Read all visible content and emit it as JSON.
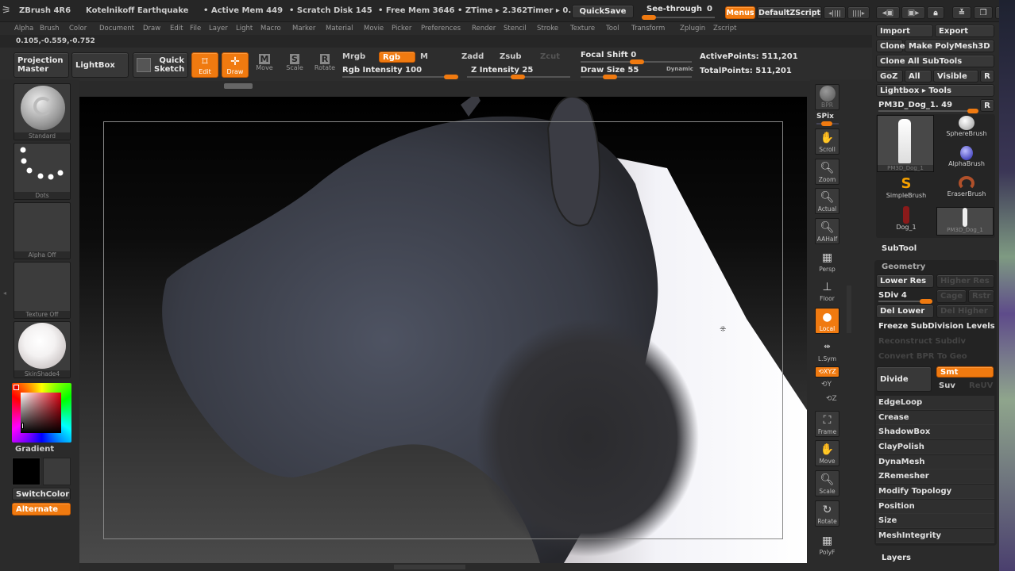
{
  "titlebar": {
    "app": "ZBrush 4R6",
    "document": "Kotelnikoff Earthquake",
    "active_mem": "• Active Mem 449",
    "scratch_disk": "• Scratch Disk 145",
    "free_mem": "• Free Mem 3646",
    "ztime": "• ZTime ▸ 2.362",
    "timer": "Timer ▸ 0.",
    "quicksave": "QuickSave",
    "see_through_label": "See-through",
    "see_through_value": "0",
    "menus": "Menus",
    "default_zscript": "DefaultZScript"
  },
  "menubar": [
    "Alpha",
    "Brush",
    "Color",
    "Document",
    "Draw",
    "Edit",
    "File",
    "Layer",
    "Light",
    "Macro",
    "Marker",
    "Material",
    "Movie",
    "Picker",
    "Preferences",
    "Render",
    "Stencil",
    "Stroke",
    "Texture",
    "Tool",
    "Transform",
    "Zplugin",
    "Zscript"
  ],
  "coords": "0.105,-0.559,-0.752",
  "shelf": {
    "projection_master": "Projection Master",
    "lightbox": "LightBox",
    "quick_sketch": "Quick Sketch",
    "edit": "Edit",
    "draw": "Draw",
    "move": "Move",
    "scale": "Scale",
    "rotate": "Rotate",
    "mrgb": "Mrgb",
    "rgb": "Rgb",
    "m": "M",
    "rgb_intensity": "Rgb Intensity 100",
    "zadd": "Zadd",
    "zsub": "Zsub",
    "zcut": "Zcut",
    "z_intensity": "Z Intensity 25",
    "focal_shift": "Focal Shift 0",
    "draw_size": "Draw Size 55",
    "dynamic": "Dynamic",
    "active_points": "ActivePoints: 511,201",
    "total_points": "TotalPoints: 511,201"
  },
  "left_tray": {
    "brush": "Standard",
    "stroke": "Dots",
    "alpha": "Alpha  Off",
    "texture": "Texture  Off",
    "material": "SkinShade4",
    "gradient": "Gradient",
    "switch_color": "SwitchColor",
    "alternate": "Alternate"
  },
  "right_tray": {
    "bpr": "BPR",
    "spix": "SPix",
    "buttons": [
      "Scroll",
      "Zoom",
      "Actual",
      "AAHalf",
      "Persp",
      "Floor",
      "Local",
      "L.Sym",
      "XYZ",
      "Y",
      "Z",
      "Frame",
      "Move",
      "Scale",
      "Rotate",
      "PolyF"
    ]
  },
  "tool_panel": {
    "import": "Import",
    "export": "Export",
    "clone": "Clone",
    "make_polymesh": "Make PolyMesh3D",
    "clone_all": "Clone All SubTools",
    "goz": "GoZ",
    "all": "All",
    "visible": "Visible",
    "r": "R",
    "lightbox_tools": "Lightbox ▸ Tools",
    "current_tool": "PM3D_Dog_1. 49",
    "tools": [
      "PM3D_Dog_1",
      "SphereBrush",
      "AlphaBrush",
      "SimpleBrush",
      "EraserBrush",
      "Dog_1",
      "PM3D_Dog_1"
    ],
    "subtool": "SubTool",
    "geometry": "Geometry",
    "lower_res": "Lower Res",
    "higher_res": "Higher Res",
    "sdiv": "SDiv 4",
    "cage": "Cage",
    "rstr": "Rstr",
    "del_lower": "Del Lower",
    "del_higher": "Del Higher",
    "freeze": "Freeze SubDivision Levels",
    "reconstruct": "Reconstruct Subdiv",
    "convert_bpr": "Convert BPR To Geo",
    "divide": "Divide",
    "smt": "Smt",
    "suv": "Suv",
    "reuv": "ReUV",
    "sections": [
      "EdgeLoop",
      "Crease",
      "ShadowBox",
      "ClayPolish",
      "DynaMesh",
      "ZRemesher",
      "Modify Topology",
      "Position",
      "Size",
      "MeshIntegrity"
    ],
    "layers": "Layers"
  },
  "colors": {
    "accent": "#f07a10"
  }
}
